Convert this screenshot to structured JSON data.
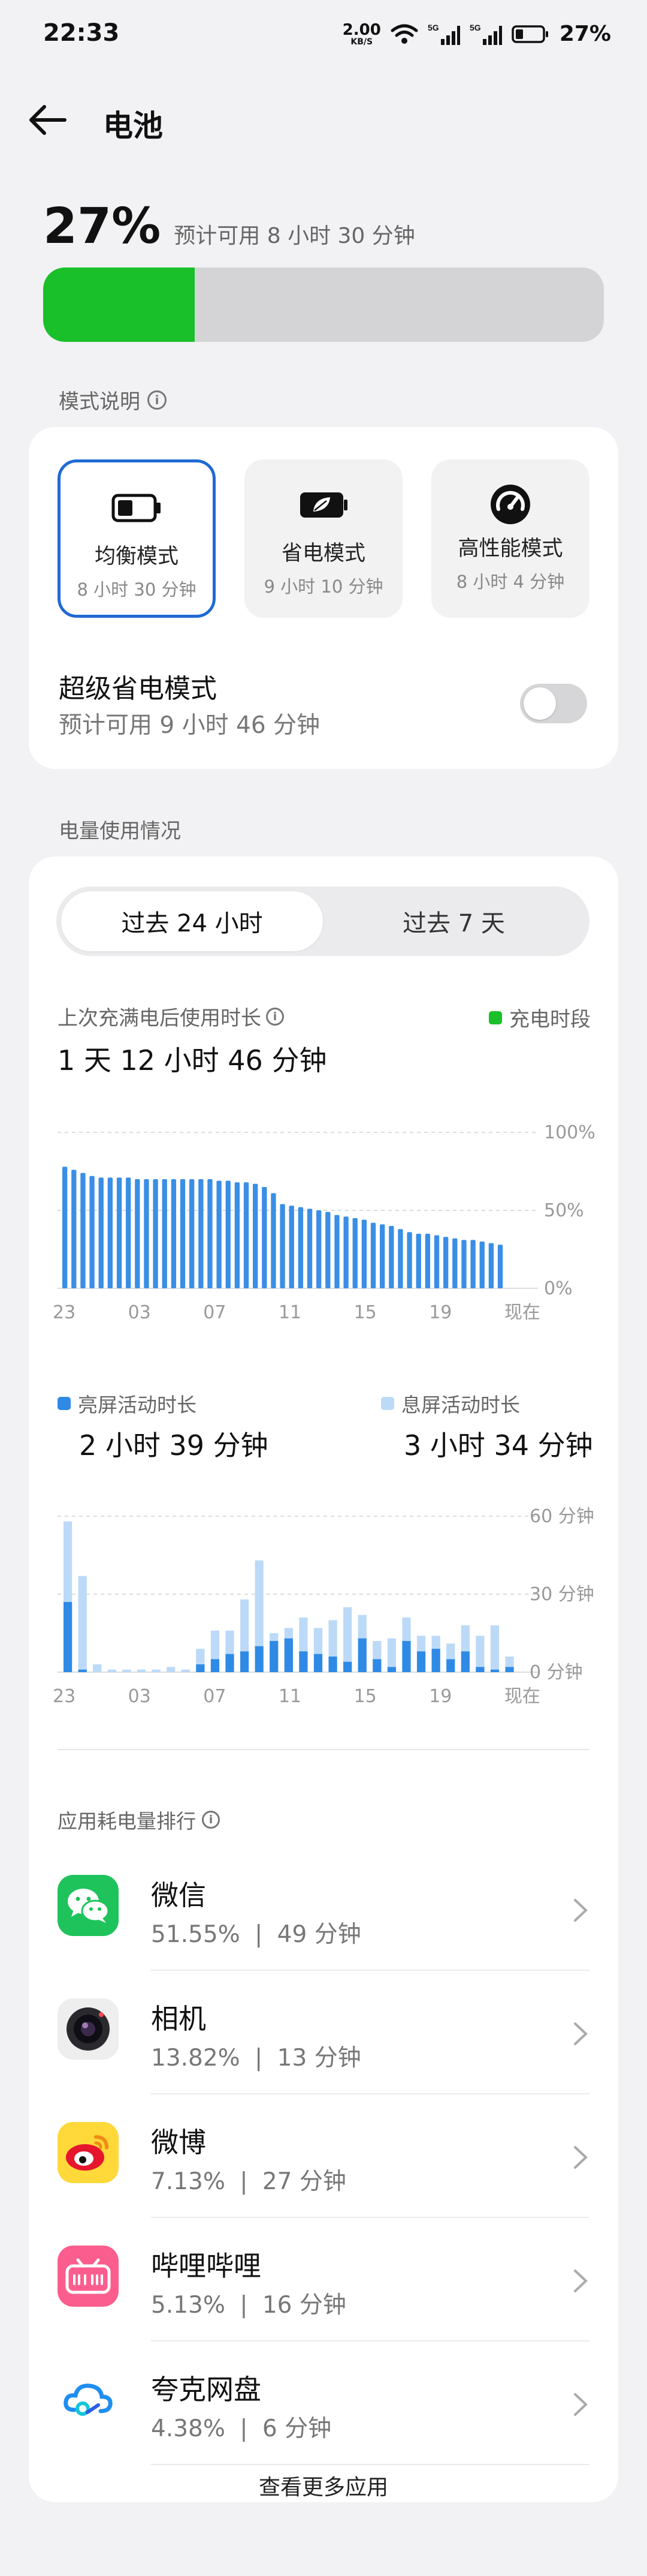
{
  "status_bar": {
    "time": "22:33",
    "net_speed": "2.00",
    "net_unit": "KB/S",
    "sim1": "5G",
    "sim2": "5G",
    "battery": "27%"
  },
  "header": {
    "title": "电池"
  },
  "battery": {
    "percent": "27%",
    "level": 0.27,
    "estimate": "预计可用 8 小时 30 分钟",
    "fill_color": "#19c029"
  },
  "modes_section": {
    "label": "模式说明",
    "modes": [
      {
        "name": "均衡模式",
        "time": "8 小时 30 分钟",
        "icon": "battery-icon",
        "selected": true
      },
      {
        "name": "省电模式",
        "time": "9 小时 10 分钟",
        "icon": "leaf-battery-icon",
        "selected": false
      },
      {
        "name": "高性能模式",
        "time": "8 小时 4 分钟",
        "icon": "speedometer-icon",
        "selected": false
      }
    ],
    "super_saver": {
      "title": "超级省电模式",
      "subtitle": "预计可用 9 小时 46 分钟",
      "enabled": false
    }
  },
  "usage": {
    "label": "电量使用情况",
    "tabs": [
      "过去 24 小时",
      "过去 7 天"
    ],
    "active_tab": 0,
    "since_label": "上次充满电后使用时长",
    "since_value": "1 天 12 小时 46 分钟",
    "charging_legend": "充电时段",
    "screen_on_label": "亮屏活动时长",
    "screen_on_value": "2 小时 39 分钟",
    "screen_off_label": "息屏活动时长",
    "screen_off_value": "3 小时 34 分钟",
    "colors": {
      "level": "#3a8ee6",
      "screen_on": "#2f8ae6",
      "screen_off": "#bcdaf8",
      "charging": "#19c029"
    }
  },
  "chart_data": [
    {
      "type": "bar",
      "ylim": [
        0,
        100
      ],
      "y_ticks": [
        "100%",
        "50%",
        "0%"
      ],
      "x_ticks": [
        "23",
        "03",
        "07",
        "11",
        "15",
        "19",
        "现在"
      ],
      "values": [
        78,
        76,
        74,
        72,
        71,
        71,
        71,
        71,
        70,
        70,
        70,
        70,
        70,
        70,
        70,
        70,
        70,
        69,
        69,
        68,
        68,
        67,
        65,
        61,
        54,
        53,
        52,
        51,
        50,
        49,
        47,
        46,
        45,
        44,
        42,
        41,
        40,
        38,
        36,
        35,
        35,
        34,
        33,
        32,
        31,
        31,
        30,
        29,
        28
      ]
    },
    {
      "type": "bar",
      "ylim": [
        0,
        60
      ],
      "y_ticks": [
        "60 分钟",
        "30 分钟",
        "0 分钟"
      ],
      "x_ticks": [
        "23",
        "03",
        "07",
        "11",
        "15",
        "19",
        "现在"
      ],
      "series": [
        {
          "name": "亮屏活动时长",
          "values": [
            27,
            1,
            0,
            0,
            0,
            0,
            0,
            0,
            0,
            3,
            5,
            7,
            8,
            10,
            12,
            13,
            8,
            7,
            6,
            4,
            13,
            5,
            2,
            12,
            8,
            9,
            5,
            8,
            2,
            1,
            2
          ]
        },
        {
          "name": "息屏活动时长",
          "values": [
            31,
            36,
            3,
            1,
            1,
            1,
            1,
            2,
            1,
            6,
            11,
            9,
            20,
            33,
            3,
            4,
            13,
            10,
            14,
            21,
            9,
            7,
            11,
            9,
            6,
            5,
            6,
            10,
            12,
            17,
            4
          ]
        }
      ]
    }
  ],
  "apps_section": {
    "label": "应用耗电量排行",
    "apps": [
      {
        "name": "微信",
        "percent": "51.55%",
        "duration": "49 分钟",
        "icon": "wechat-icon"
      },
      {
        "name": "相机",
        "percent": "13.82%",
        "duration": "13 分钟",
        "icon": "camera-icon"
      },
      {
        "name": "微博",
        "percent": "7.13%",
        "duration": "27 分钟",
        "icon": "weibo-icon"
      },
      {
        "name": "哔哩哔哩",
        "percent": "5.13%",
        "duration": "16 分钟",
        "icon": "bilibili-icon"
      },
      {
        "name": "夸克网盘",
        "percent": "4.38%",
        "duration": "6 分钟",
        "icon": "quark-cloud-icon"
      }
    ],
    "separator": "|",
    "more_label": "查看更多应用"
  }
}
